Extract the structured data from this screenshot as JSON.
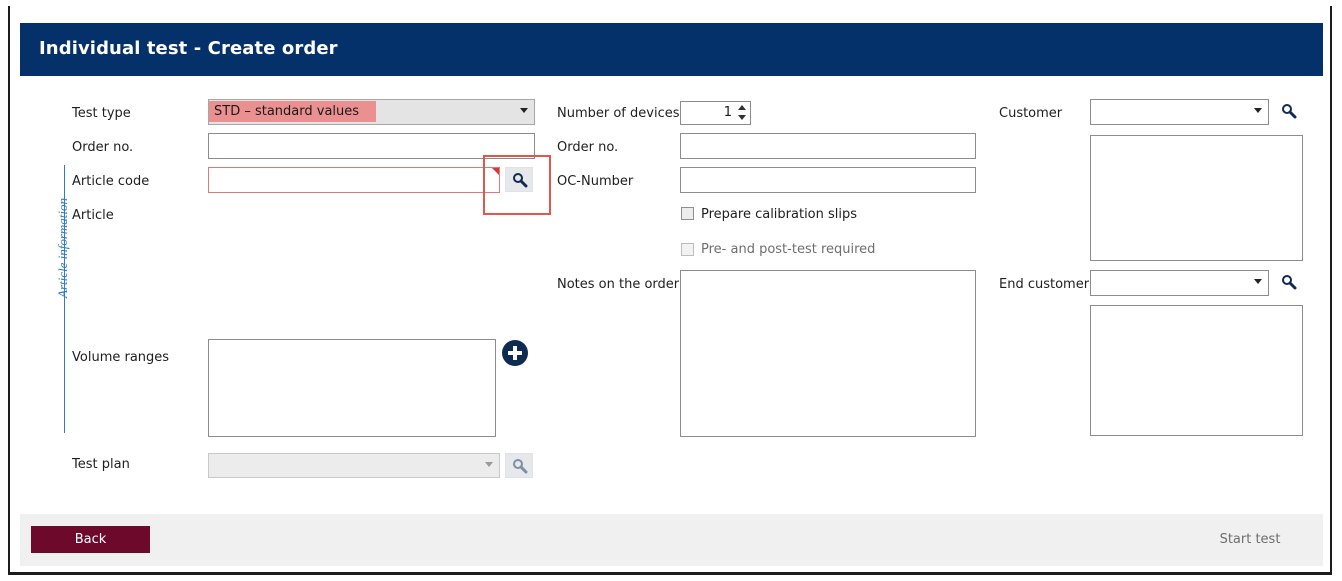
{
  "window": {
    "title": "Individual test - Create order"
  },
  "article_section": {
    "group_label": "Article information",
    "test_type": {
      "label": "Test type",
      "value": "STD – standard values"
    },
    "order_no": {
      "label": "Order no.",
      "value": ""
    },
    "article_code": {
      "label": "Article code",
      "value": ""
    },
    "article": {
      "label": "Article"
    },
    "volume_ranges": {
      "label": "Volume ranges"
    },
    "test_plan": {
      "label": "Test plan",
      "value": ""
    }
  },
  "order_section": {
    "number_of_devices": {
      "label": "Number of devices",
      "value": "1"
    },
    "order_no": {
      "label": "Order no.",
      "value": ""
    },
    "oc_number": {
      "label": "OC-Number",
      "value": ""
    },
    "prepare_calibration_slips": {
      "label": "Prepare calibration slips",
      "checked": false
    },
    "pre_post_test_required": {
      "label": "Pre- and post-test required",
      "checked": false,
      "enabled": false
    },
    "notes": {
      "label": "Notes on the order",
      "value": ""
    }
  },
  "customer_section": {
    "customer": {
      "label": "Customer",
      "value": ""
    },
    "end_customer": {
      "label": "End customer",
      "value": ""
    }
  },
  "footer": {
    "back_label": "Back",
    "start_label": "Start test"
  },
  "colors": {
    "titlebar": "#05316b",
    "back_button": "#6d0a2c",
    "test_type_highlight": "#eb9090",
    "annotation_box": "#e2574c",
    "group_accent": "#2e7bc6"
  }
}
